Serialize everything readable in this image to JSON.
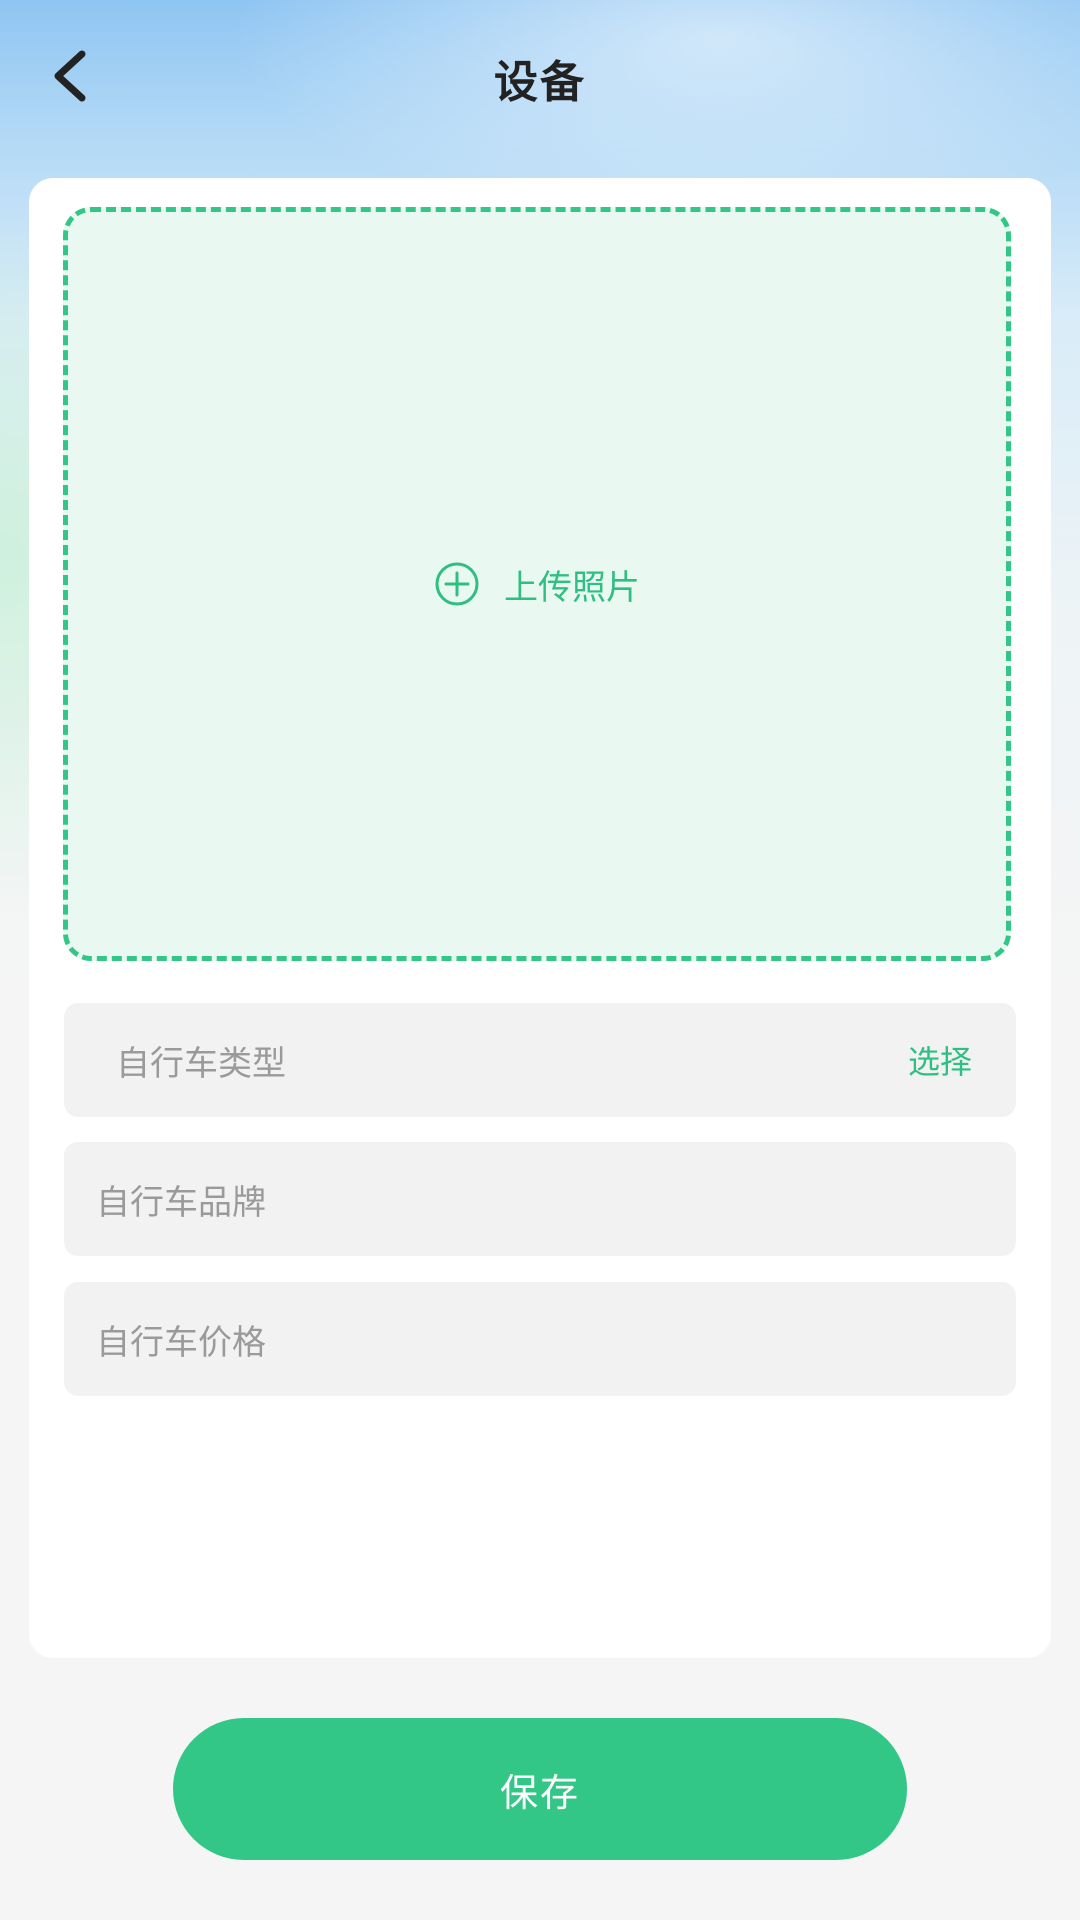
{
  "header": {
    "title": "设备",
    "back_icon": "chevron-left-icon"
  },
  "upload": {
    "icon": "plus-circle-icon",
    "label": "上传照片"
  },
  "fields": {
    "type": {
      "label": "自行车类型",
      "action": "选择"
    },
    "brand": {
      "placeholder": "自行车品牌"
    },
    "price": {
      "placeholder": "自行车价格"
    }
  },
  "footer": {
    "save_label": "保存"
  },
  "colors": {
    "accent": "#33c787",
    "upload_bg": "#e9f8f1",
    "field_bg": "#f2f2f2",
    "title_text": "#222222",
    "placeholder_text": "#9a9a9a"
  }
}
